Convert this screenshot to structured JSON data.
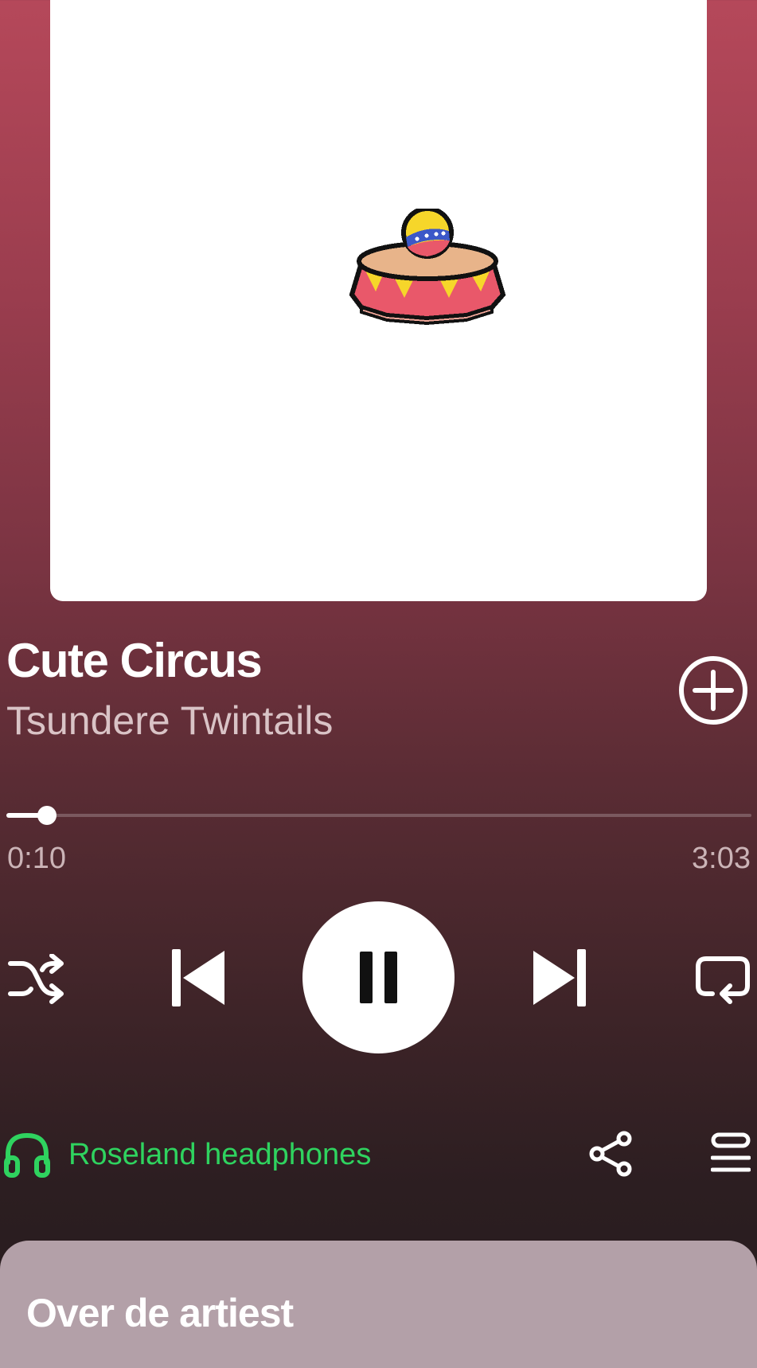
{
  "track": {
    "title": "Cute Circus",
    "artist": "Tsundere Twintails"
  },
  "progress": {
    "elapsed": "0:10",
    "total": "3:03",
    "fraction": 0.055
  },
  "controls": {
    "shuffle_icon": "shuffle-icon",
    "previous_icon": "skip-previous-icon",
    "pause_icon": "pause-icon",
    "next_icon": "skip-next-icon",
    "repeat_icon": "repeat-icon",
    "add_icon": "add-circle-icon"
  },
  "device": {
    "label": "Roseland headphones",
    "icon": "headphones-icon",
    "color": "#2fd35f"
  },
  "actions": {
    "share_icon": "share-icon",
    "queue_icon": "queue-icon"
  },
  "about_card": {
    "title": "Over de artiest"
  },
  "colors": {
    "accent_green": "#2fd35f",
    "background_top": "#b5485a",
    "background_bottom": "#261b1d"
  }
}
